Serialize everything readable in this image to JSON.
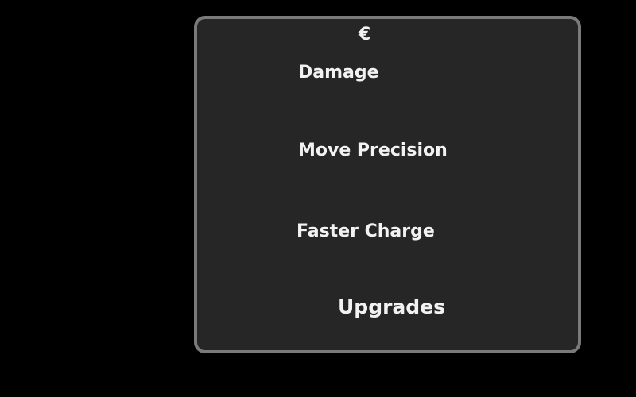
{
  "shop": {
    "currency_symbol": "€",
    "title": "Upgrades",
    "items": [
      {
        "label": "Damage"
      },
      {
        "label": "Move Precision"
      },
      {
        "label": "Faster Charge"
      }
    ]
  },
  "colors": {
    "background": "#000000",
    "panel": "#262626",
    "panel_border": "#7a7a7a",
    "text": "#f2f2f2"
  }
}
